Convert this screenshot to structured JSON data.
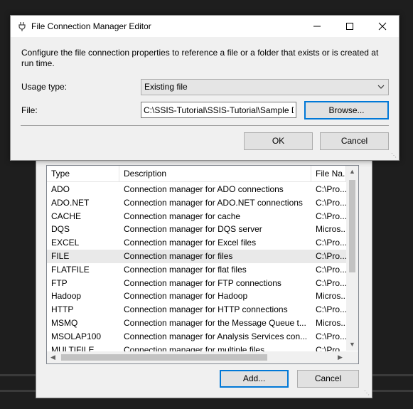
{
  "editor": {
    "title": "File Connection Manager Editor",
    "description": "Configure the file connection properties to reference a file or a folder that exists or is created at run time.",
    "usage_type_label": "Usage type:",
    "usage_type_value": "Existing file",
    "file_label": "File:",
    "file_value": "C:\\SSIS-Tutorial\\SSIS-Tutorial\\Sample Da",
    "browse_label": "Browse...",
    "ok_label": "OK",
    "cancel_label": "Cancel",
    "titlebar_icons": [
      "minimize-icon",
      "maximize-icon",
      "close-icon"
    ]
  },
  "connection_list": {
    "columns": [
      "Type",
      "Description",
      "File Na..."
    ],
    "selected": "FILE",
    "rows": [
      {
        "type": "ADO",
        "description": "Connection manager for ADO connections",
        "file": "C:\\Pro..."
      },
      {
        "type": "ADO.NET",
        "description": "Connection manager for ADO.NET connections",
        "file": "C:\\Pro..."
      },
      {
        "type": "CACHE",
        "description": "Connection manager for cache",
        "file": "C:\\Pro..."
      },
      {
        "type": "DQS",
        "description": "Connection manager for DQS server",
        "file": "Micros..."
      },
      {
        "type": "EXCEL",
        "description": "Connection manager for Excel files",
        "file": "C:\\Pro..."
      },
      {
        "type": "FILE",
        "description": "Connection manager for files",
        "file": "C:\\Pro..."
      },
      {
        "type": "FLATFILE",
        "description": "Connection manager for flat files",
        "file": "C:\\Pro..."
      },
      {
        "type": "FTP",
        "description": "Connection manager for FTP connections",
        "file": "C:\\Pro..."
      },
      {
        "type": "Hadoop",
        "description": "Connection manager for Hadoop",
        "file": "Micros..."
      },
      {
        "type": "HTTP",
        "description": "Connection manager for HTTP connections",
        "file": "C:\\Pro..."
      },
      {
        "type": "MSMQ",
        "description": "Connection manager for the Message Queue t...",
        "file": "Micros..."
      },
      {
        "type": "MSOLAP100",
        "description": "Connection manager for Analysis Services con...",
        "file": "C:\\Pro..."
      },
      {
        "type": "MULTIFILE",
        "description": "Connection manager for multiple files",
        "file": "C:\\Pro..."
      }
    ],
    "add_label": "Add...",
    "cancel_label": "Cancel"
  },
  "colors": {
    "accent": "#0078d7",
    "selected_row": "#e9e9e9",
    "backdrop": "#1e1e1e"
  }
}
